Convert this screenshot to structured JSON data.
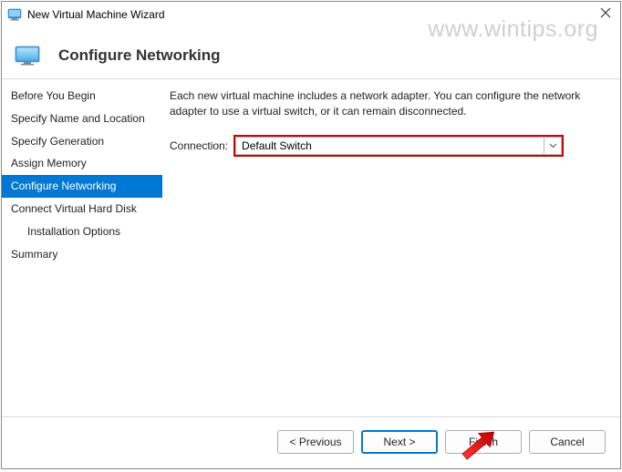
{
  "window": {
    "title": "New Virtual Machine Wizard"
  },
  "watermark": "www.wintips.org",
  "header": {
    "title": "Configure Networking"
  },
  "sidebar": {
    "items": [
      {
        "label": "Before You Begin",
        "active": false,
        "indent": false
      },
      {
        "label": "Specify Name and Location",
        "active": false,
        "indent": false
      },
      {
        "label": "Specify Generation",
        "active": false,
        "indent": false
      },
      {
        "label": "Assign Memory",
        "active": false,
        "indent": false
      },
      {
        "label": "Configure Networking",
        "active": true,
        "indent": false
      },
      {
        "label": "Connect Virtual Hard Disk",
        "active": false,
        "indent": false
      },
      {
        "label": "Installation Options",
        "active": false,
        "indent": true
      },
      {
        "label": "Summary",
        "active": false,
        "indent": false
      }
    ]
  },
  "content": {
    "description": "Each new virtual machine includes a network adapter. You can configure the network adapter to use a virtual switch, or it can remain disconnected.",
    "connection_label": "Connection:",
    "connection_value": "Default Switch"
  },
  "footer": {
    "previous": "< Previous",
    "next": "Next >",
    "finish": "Finish",
    "cancel": "Cancel"
  }
}
